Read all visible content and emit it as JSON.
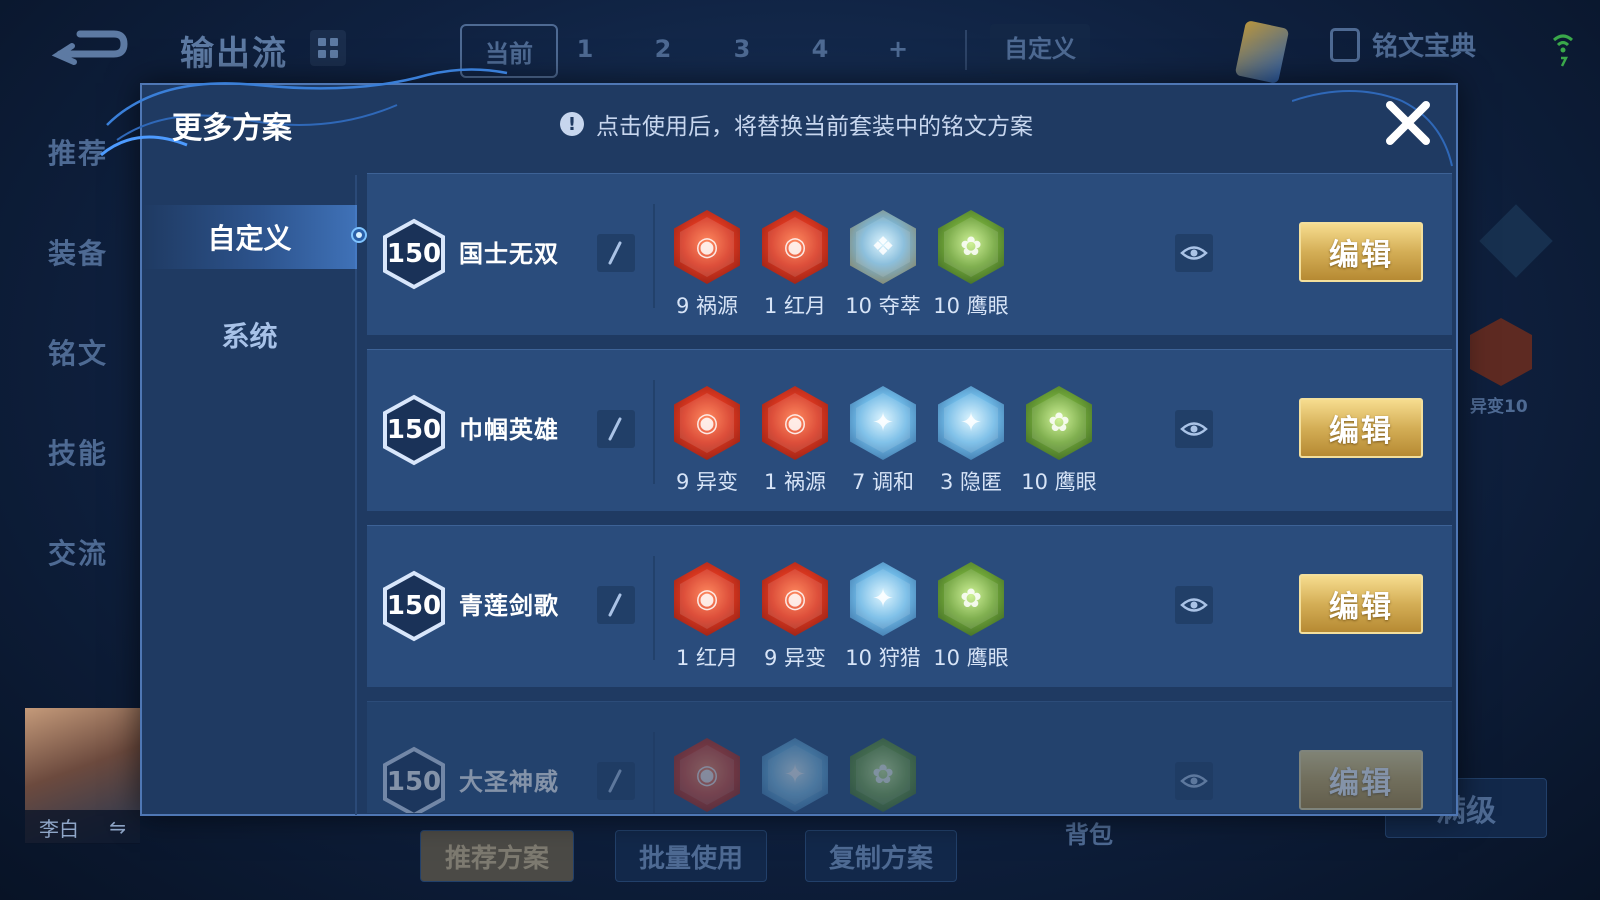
{
  "background": {
    "title": "输出流",
    "tabs": [
      "当前",
      "1",
      "2",
      "3",
      "4",
      "+"
    ],
    "custom_tab": "自定义",
    "book_label": "铭文宝典",
    "side_nav": [
      "推荐",
      "装备",
      "铭文",
      "技能",
      "交流"
    ],
    "hero_name": "李白",
    "bottom_buttons": [
      "推荐方案",
      "批量使用",
      "复制方案"
    ],
    "bag_label": "背包",
    "max_label": "满级",
    "mutation_label": "异变10"
  },
  "modal": {
    "title": "更多方案",
    "notice": "点击使用后，将替换当前套装中的铭文方案",
    "tabs": [
      {
        "label": "自定义",
        "active": true
      },
      {
        "label": "系统",
        "active": false
      }
    ],
    "edit_label": "编辑",
    "rows": [
      {
        "level": "150",
        "name": "国士无双",
        "runes": [
          {
            "count": "9",
            "name": "祸源",
            "color": "red"
          },
          {
            "count": "1",
            "name": "红月",
            "color": "red"
          },
          {
            "count": "10",
            "name": "夺萃",
            "color": "bluegold"
          },
          {
            "count": "10",
            "name": "鹰眼",
            "color": "green"
          }
        ]
      },
      {
        "level": "150",
        "name": "巾帼英雄",
        "runes": [
          {
            "count": "9",
            "name": "异变",
            "color": "red"
          },
          {
            "count": "1",
            "name": "祸源",
            "color": "red"
          },
          {
            "count": "7",
            "name": "调和",
            "color": "blue"
          },
          {
            "count": "3",
            "name": "隐匿",
            "color": "blue"
          },
          {
            "count": "10",
            "name": "鹰眼",
            "color": "green"
          }
        ]
      },
      {
        "level": "150",
        "name": "青莲剑歌",
        "runes": [
          {
            "count": "1",
            "name": "红月",
            "color": "red"
          },
          {
            "count": "9",
            "name": "异变",
            "color": "red"
          },
          {
            "count": "10",
            "name": "狩猎",
            "color": "blue"
          },
          {
            "count": "10",
            "name": "鹰眼",
            "color": "green"
          }
        ]
      },
      {
        "level": "150",
        "name": "大圣神威",
        "runes": [
          {
            "count": "",
            "name": "",
            "color": "red"
          },
          {
            "count": "",
            "name": "",
            "color": "blue"
          },
          {
            "count": "",
            "name": "",
            "color": "green"
          }
        ]
      }
    ]
  }
}
